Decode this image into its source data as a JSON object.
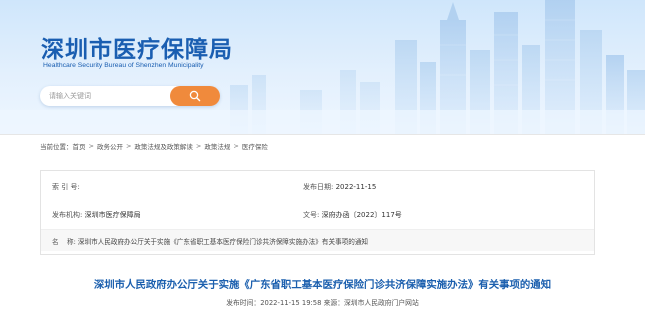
{
  "header": {
    "title": "深圳市医疗保障局",
    "subtitle": "Healthcare Security Bureau of Shenzhen Municipality",
    "search_placeholder": "请输入关键词",
    "search_icon": "search-icon",
    "accent_color": "#f08a3c",
    "brand_color": "#1a5eb1"
  },
  "breadcrumb": {
    "prefix": "当前位置：",
    "items": [
      "首页",
      "政务公开",
      "政策法规及政策解读",
      "政策法规",
      "医疗保险"
    ],
    "separator": ">"
  },
  "info": {
    "index_label": "索 引 号:",
    "index_value": "",
    "publish_date_label": "发布日期:",
    "publish_date_value": "2022-11-15",
    "publisher_label": "发布机构:",
    "publisher_value": "深圳市医疗保障局",
    "doc_no_label": "文号:",
    "doc_no_value": "深府办函〔2022〕117号",
    "name_label": "名    称:",
    "name_value": "深圳市人民政府办公厅关于实施《广东省职工基本医疗保险门诊共济保障实施办法》有关事项的通知"
  },
  "article": {
    "title": "深圳市人民政府办公厅关于实施《广东省职工基本医疗保险门诊共济保障实施办法》有关事项的通知",
    "meta": "发布时间：2022-11-15 19:58 来源：深圳市人民政府门户网站"
  }
}
